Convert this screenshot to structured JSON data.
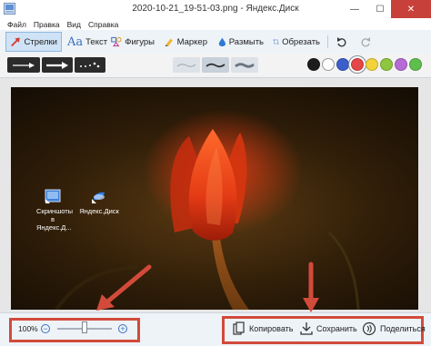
{
  "window": {
    "title": "2020-10-21_19-51-03.png - Яндекс.Диск",
    "minimize_glyph": "—",
    "maximize_glyph": "☐",
    "close_glyph": "✕"
  },
  "menu": [
    "Файл",
    "Правка",
    "Вид",
    "Справка"
  ],
  "toolbar": {
    "arrows_label": "Стрелки",
    "text_label": "Текст",
    "shapes_label": "Фигуры",
    "marker_label": "Маркер",
    "blur_label": "Размыть",
    "crop_label": "Обрезать",
    "text_glyph": "Aa"
  },
  "palette_colors": [
    "#1c1c1c",
    "#ffffff",
    "#3a5fcd",
    "#e54646",
    "#f2d43a",
    "#8ec63f",
    "#b66bd6",
    "#5fbf4e"
  ],
  "accent_selected_color": "#e54646",
  "desktop_icons": [
    {
      "label_line1": "Скриншоты",
      "label_line2": "в Яндекс.Д..."
    },
    {
      "label_line1": "Яндекс.Диск",
      "label_line2": ""
    }
  ],
  "bottombar": {
    "zoom_value": "100%",
    "minus_glyph": "−",
    "plus_glyph": "+",
    "zoom_slider_fraction": 0.5,
    "copy_label": "Копировать",
    "save_label": "Сохранить",
    "share_label": "Поделиться"
  },
  "annotation_color": "#d24a3a"
}
